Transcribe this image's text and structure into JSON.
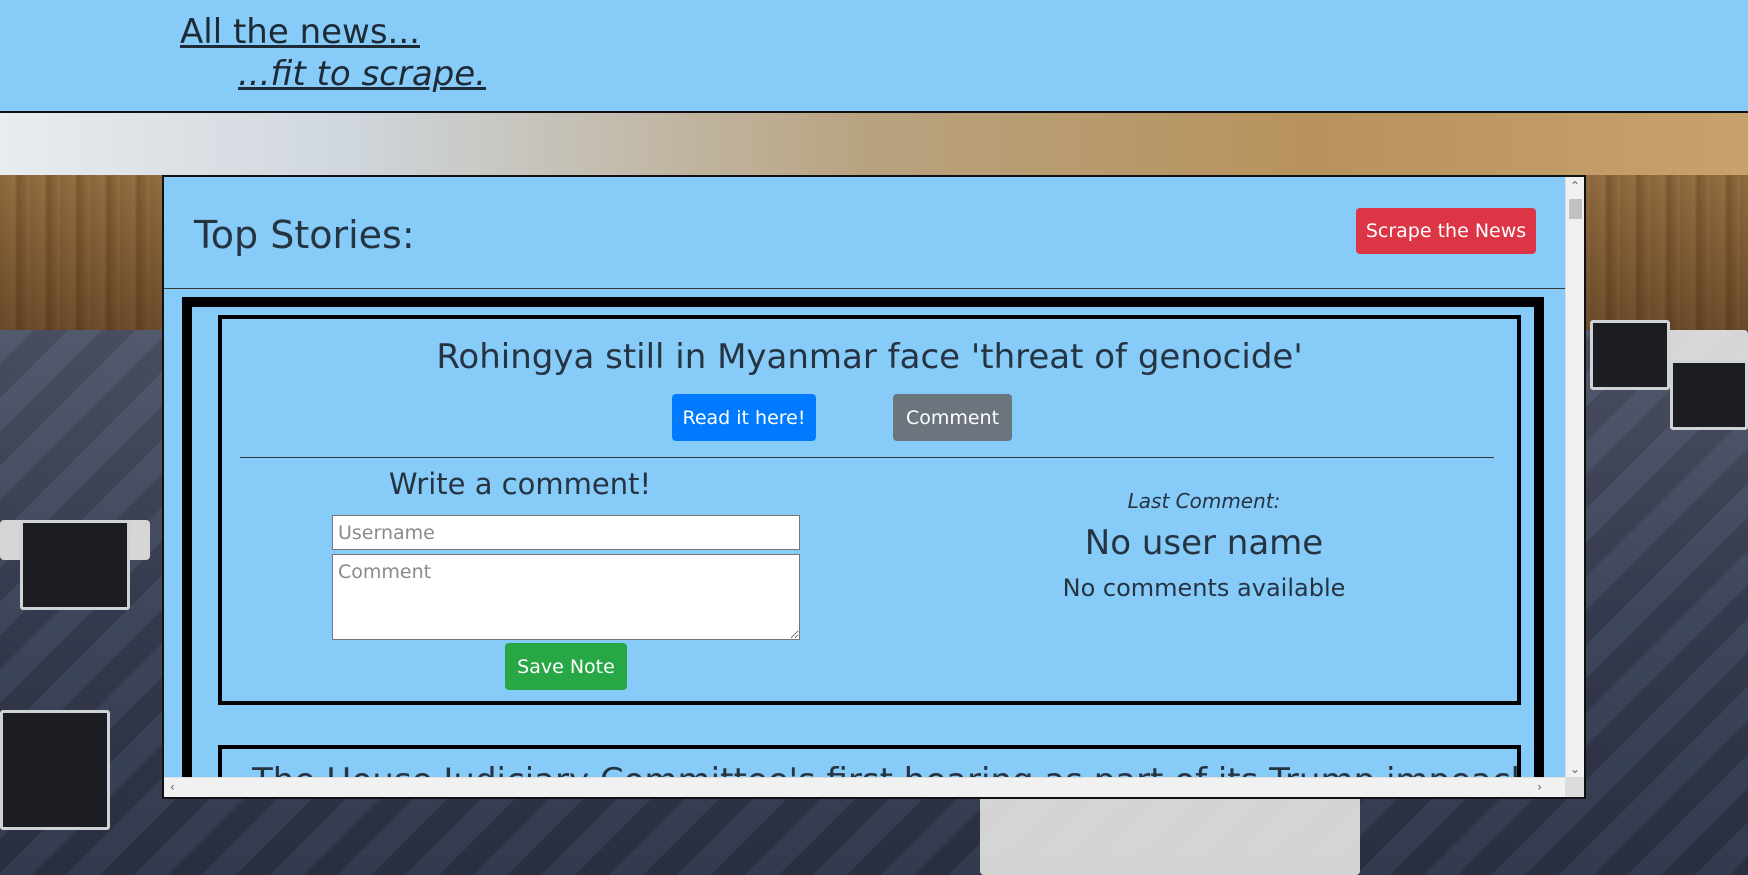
{
  "brand": {
    "line1": "All the news...",
    "line2": "...fit to scrape."
  },
  "header": {
    "title": "Top Stories:",
    "scrape_label": "Scrape the News"
  },
  "articles": [
    {
      "title": "Rohingya still in Myanmar face 'threat of genocide'",
      "read_label": "Read it here!",
      "comment_label": "Comment",
      "comment_form": {
        "heading": "Write a comment!",
        "username_placeholder": "Username",
        "comment_placeholder": "Comment",
        "save_label": "Save Note"
      },
      "last_comment": {
        "label": "Last Comment:",
        "user": "No user name",
        "text": "No comments available"
      }
    },
    {
      "title": "The House Judiciary Committee's first hearing as part of its Trump impeachment"
    }
  ],
  "colors": {
    "page_blue": "#87cbf8",
    "scrape_button": "#dc3545",
    "read_button": "#007bff",
    "comment_button": "#6c757d",
    "save_button": "#28a745"
  },
  "icons": {
    "scroll_up": "chevron-up-icon",
    "scroll_down": "chevron-down-icon",
    "scroll_left": "chevron-left-icon",
    "scroll_right": "chevron-right-icon"
  }
}
